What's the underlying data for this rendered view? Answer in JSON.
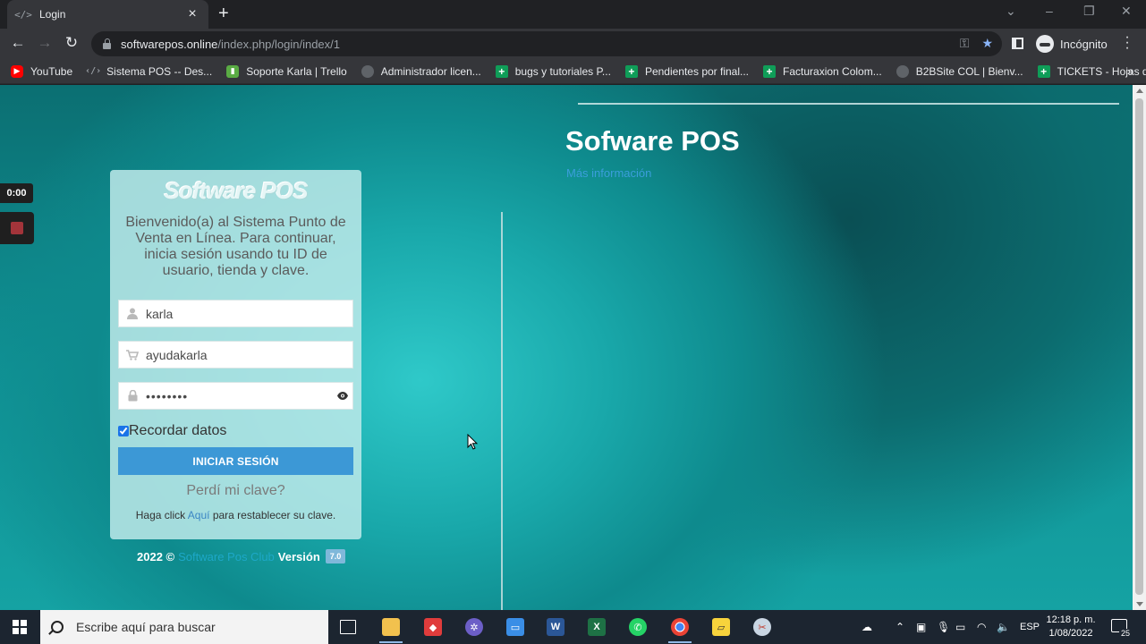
{
  "browser": {
    "tab_title": "Login",
    "tab_favicon": "</>",
    "url_host": "softwarepos.online",
    "url_path": "/index.php/login/index/1",
    "profile_label": "Incógnito",
    "bookmarks": [
      {
        "label": "YouTube",
        "icon": "youtube-icon"
      },
      {
        "label": "Sistema POS -- Des...",
        "icon": "code-icon"
      },
      {
        "label": "Soporte Karla | Trello",
        "icon": "trello-icon"
      },
      {
        "label": "Administrador licen...",
        "icon": "globe-icon"
      },
      {
        "label": "bugs y tutoriales P...",
        "icon": "sheets-icon"
      },
      {
        "label": "Pendientes por final...",
        "icon": "sheets-icon"
      },
      {
        "label": "Facturaxion Colom...",
        "icon": "sheets-icon"
      },
      {
        "label": "B2BSite COL | Bienv...",
        "icon": "globe-icon"
      },
      {
        "label": "TICKETS - Hojas de...",
        "icon": "sheets-icon"
      }
    ]
  },
  "recorder": {
    "time": "0:00"
  },
  "login": {
    "logo_text": "Software POS",
    "welcome": "Bienvenido(a) al Sistema Punto de Venta en Línea. Para continuar, inicia sesión usando tu ID de usuario, tienda y clave.",
    "user_value": "karla",
    "store_value": "ayudakarla",
    "password_value": "••••••••",
    "remember_label": "Recordar datos",
    "remember_checked": true,
    "submit_label": "INICIAR SESIÓN",
    "forgot_label": "Perdí mi clave?",
    "restore_prefix": "Haga click ",
    "restore_link": "Aquí",
    "restore_suffix": " para restablecer su clave."
  },
  "footer": {
    "year": "2022 ©",
    "brand": "Software Pos Club",
    "version_label": "Versión",
    "version": "7.0"
  },
  "hero": {
    "title": "Sofware POS",
    "link": "Más información"
  },
  "taskbar": {
    "search_placeholder": "Escribe aquí para buscar",
    "language": "ESP",
    "time": "12:18 p. m.",
    "date": "1/08/2022",
    "notifications": "25"
  },
  "colors": {
    "accent_button": "#3c98d6",
    "page_teal": "#109396",
    "link_blue": "#3b9edb"
  }
}
